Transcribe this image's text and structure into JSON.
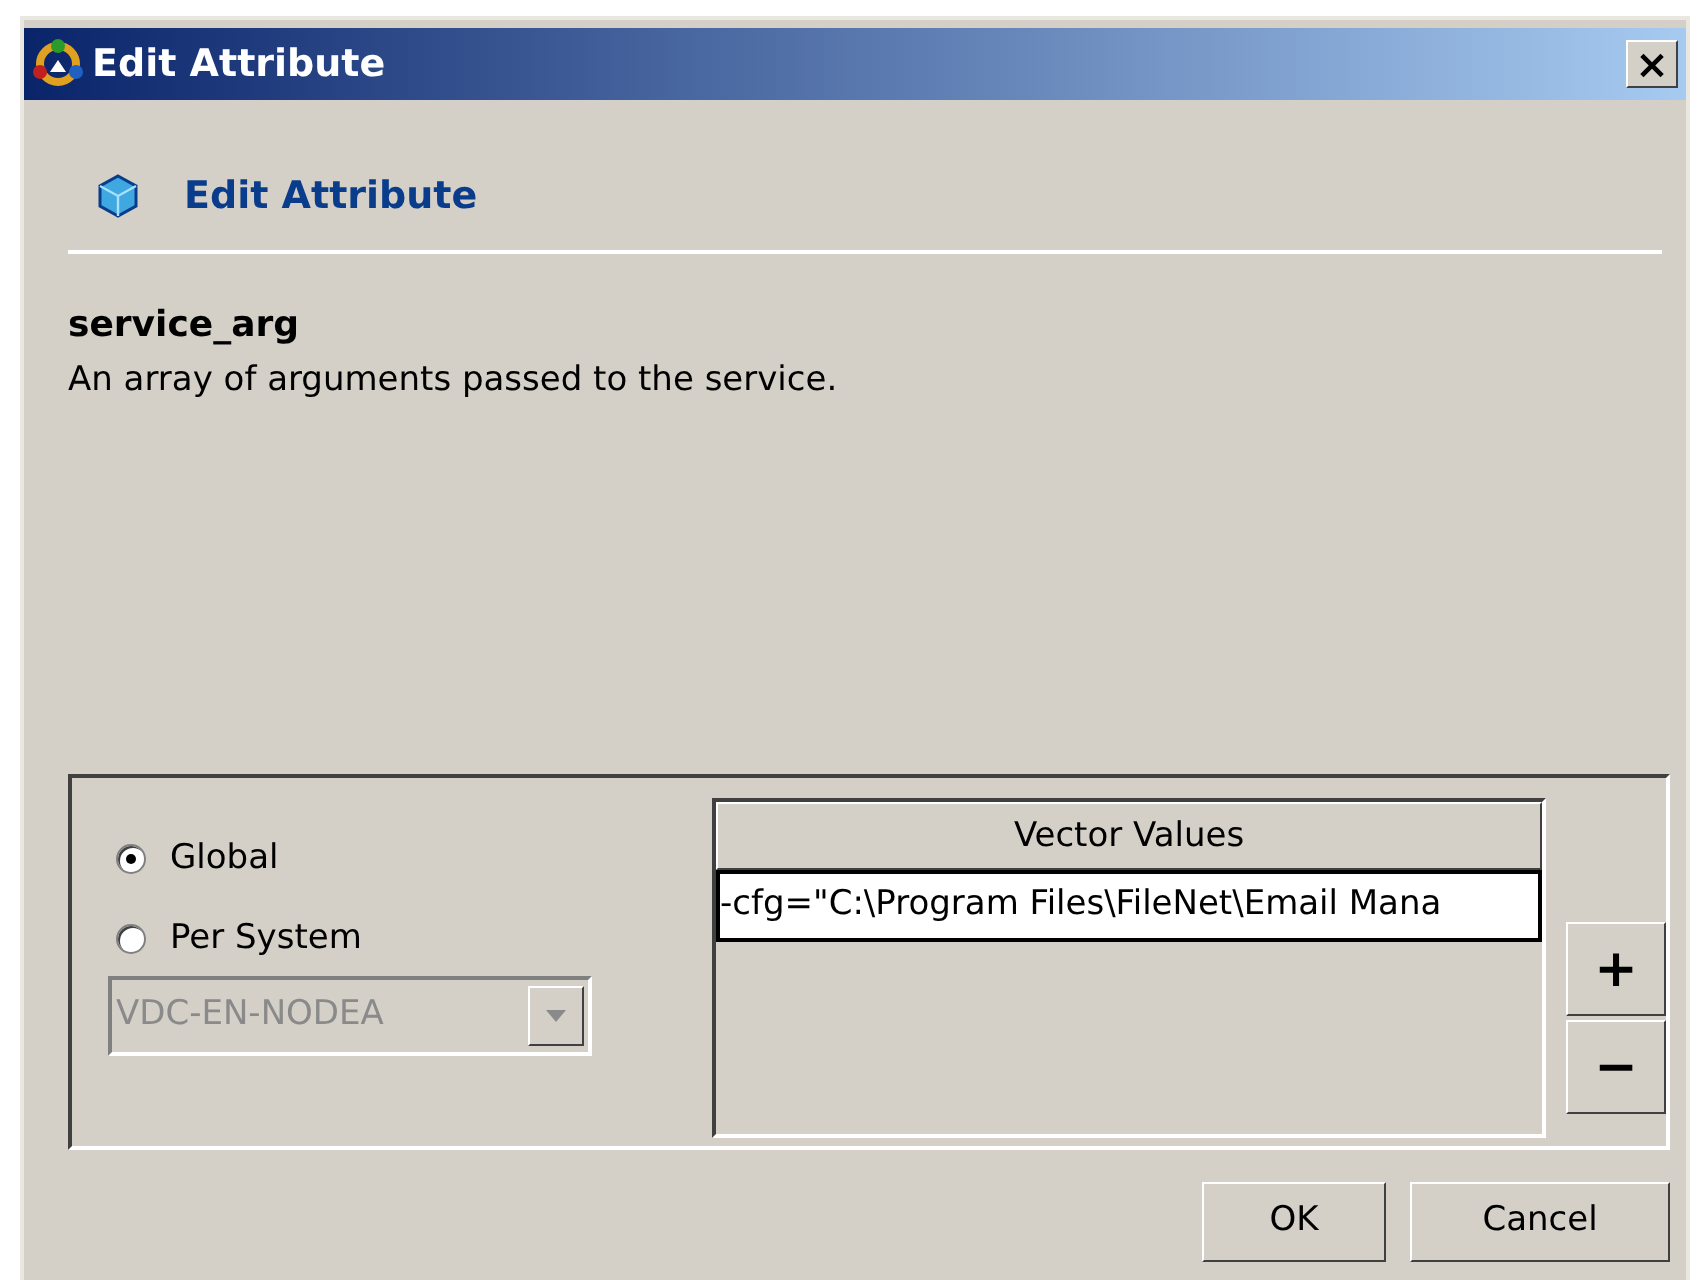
{
  "window": {
    "title": "Edit Attribute",
    "close": "×"
  },
  "header": {
    "title": "Edit Attribute"
  },
  "attribute": {
    "name": "service_arg",
    "description": "An array of arguments passed to the service."
  },
  "scope": {
    "options": [
      {
        "label": "Global",
        "selected": true
      },
      {
        "label": "Per System",
        "selected": false
      }
    ],
    "system": {
      "value": "VDC-EN-NODEA",
      "disabled": true
    }
  },
  "vector_table": {
    "columns": [
      "Vector Values"
    ],
    "rows": [
      {
        "value": "-cfg=\"C:\\Program Files\\FileNet\\Email Mana",
        "selected": true
      }
    ]
  },
  "side_buttons": [
    "+",
    "−"
  ],
  "buttons": [
    "OK",
    "Cancel"
  ]
}
